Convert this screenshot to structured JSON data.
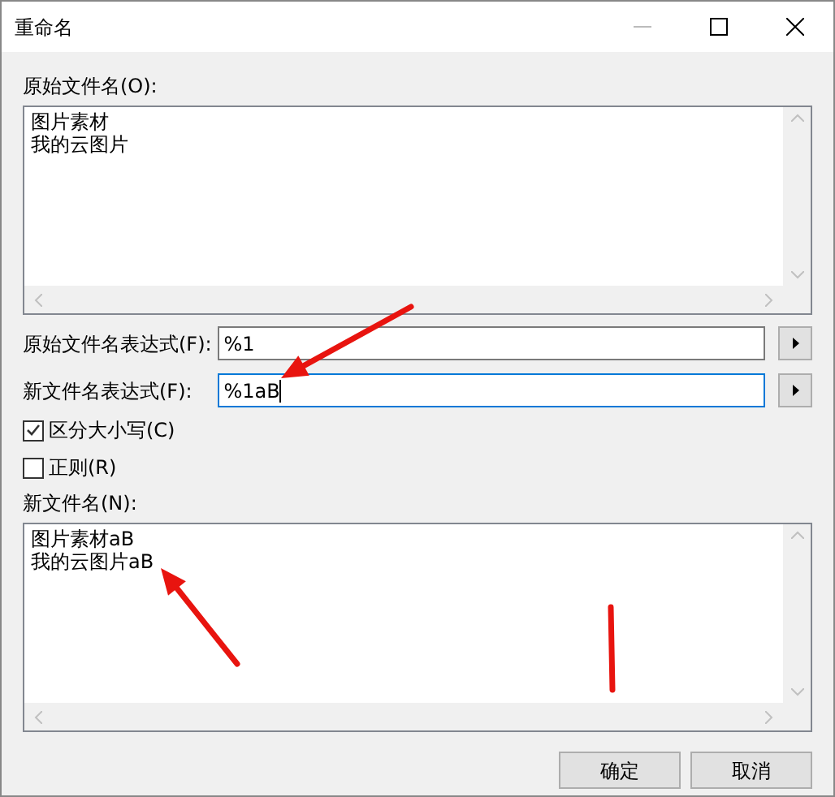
{
  "window": {
    "title": "重命名"
  },
  "original_names": {
    "label": "原始文件名(O):",
    "lines": [
      "图片素材",
      "我的云图片"
    ]
  },
  "expressions": [
    {
      "label": "原始文件名表达式(F):",
      "value": "%1",
      "focused": false
    },
    {
      "label": "新文件名表达式(F):",
      "value": "%1aB",
      "focused": true
    }
  ],
  "options": [
    {
      "label": "区分大小写(C)",
      "checked": true
    },
    {
      "label": "正则(R)",
      "checked": false
    }
  ],
  "new_names": {
    "label": "新文件名(N):",
    "lines": [
      "图片素材aB",
      "我的云图片aB"
    ]
  },
  "buttons": [
    "确定",
    "取消"
  ]
}
